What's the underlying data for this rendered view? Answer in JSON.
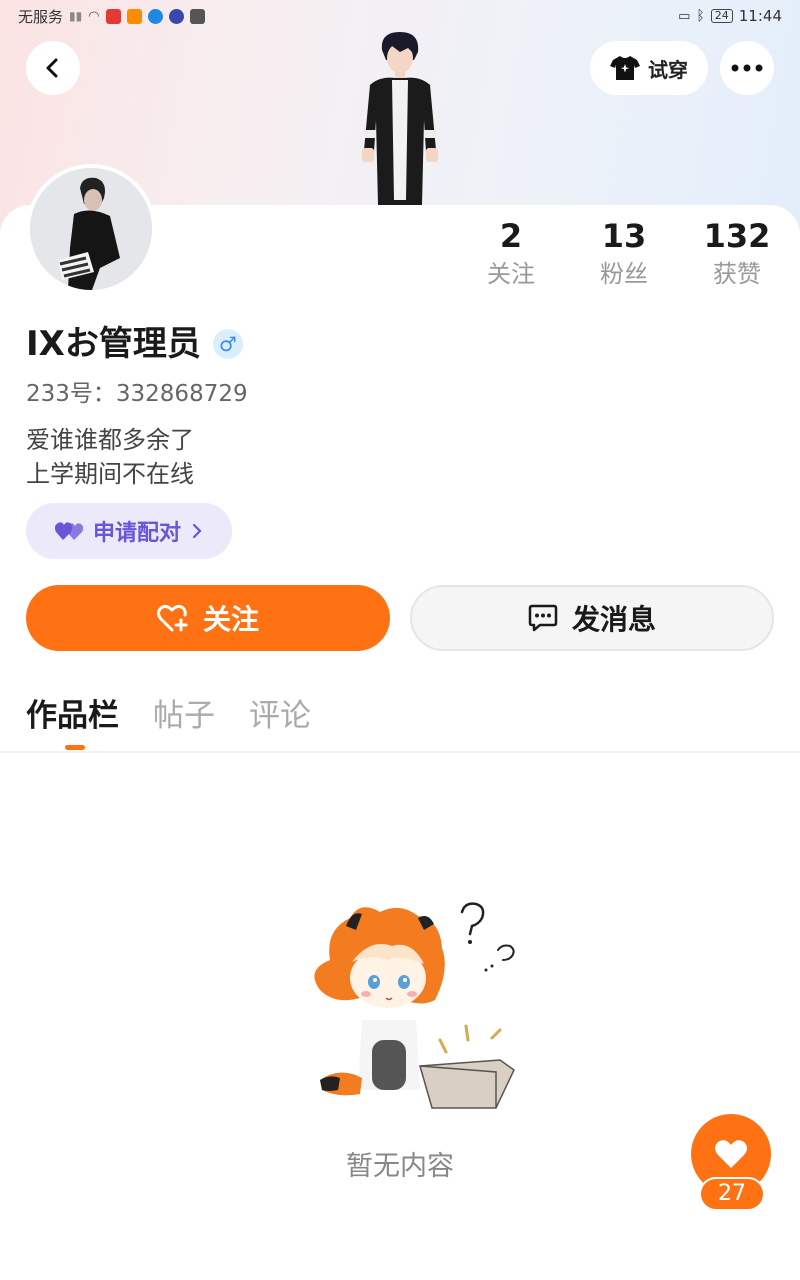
{
  "status_bar": {
    "carrier": "无服务",
    "battery": "24",
    "time": "11:44"
  },
  "header": {
    "tryon_label": "试穿"
  },
  "stats": [
    {
      "value": "2",
      "label": "关注"
    },
    {
      "value": "13",
      "label": "粉丝"
    },
    {
      "value": "132",
      "label": "获赞"
    }
  ],
  "profile": {
    "name": "IXお管理员",
    "gender_symbol": "♂",
    "uid": "233号：332868729",
    "bio_line1": "爱谁谁都多余了",
    "bio_line2": "上学期间不在线",
    "pair_label": "申请配对"
  },
  "actions": {
    "follow_label": "关注",
    "message_label": "发消息"
  },
  "tabs": [
    {
      "label": "作品栏",
      "active": true
    },
    {
      "label": "帖子",
      "active": false
    },
    {
      "label": "评论",
      "active": false
    }
  ],
  "empty_state": {
    "text": "暂无内容"
  },
  "fab": {
    "count": "27"
  },
  "colors": {
    "accent": "#ff7214",
    "pair_purple": "#6a55d8",
    "pair_bg": "#ece9fb"
  }
}
